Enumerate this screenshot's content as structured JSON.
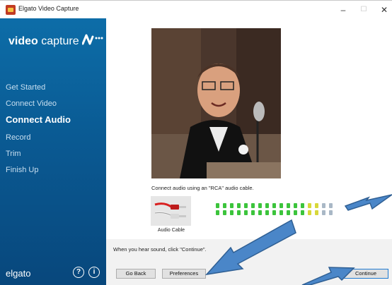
{
  "window": {
    "title": "Elgato Video Capture",
    "min_glyph": "–",
    "max_glyph": "☐",
    "close_glyph": "✕"
  },
  "sidebar": {
    "brand_bold": "video",
    "brand_light": "capture",
    "items": [
      {
        "label": "Get Started",
        "active": false
      },
      {
        "label": "Connect Video",
        "active": false
      },
      {
        "label": "Connect Audio",
        "active": true
      },
      {
        "label": "Record",
        "active": false
      },
      {
        "label": "Trim",
        "active": false
      },
      {
        "label": "Finish Up",
        "active": false
      }
    ],
    "footer_brand": "elgato",
    "help_glyph": "?",
    "info_glyph": "i"
  },
  "main": {
    "connect_text": "Connect audio using an \"RCA\" audio cable.",
    "cable_label": "Audio Cable",
    "meter": {
      "segments": 17,
      "level": 0.88
    },
    "hint": "When you hear sound, click \"Continue\"."
  },
  "buttons": {
    "back": "Go Back",
    "preferences": "Preferences",
    "continue": "Continue"
  },
  "colors": {
    "sidebar": "#0a5a93",
    "meter_green": "#3cc43c",
    "meter_yellow": "#d8d83a",
    "meter_off": "#a9b8c6",
    "arrow": "#4a86c8"
  }
}
